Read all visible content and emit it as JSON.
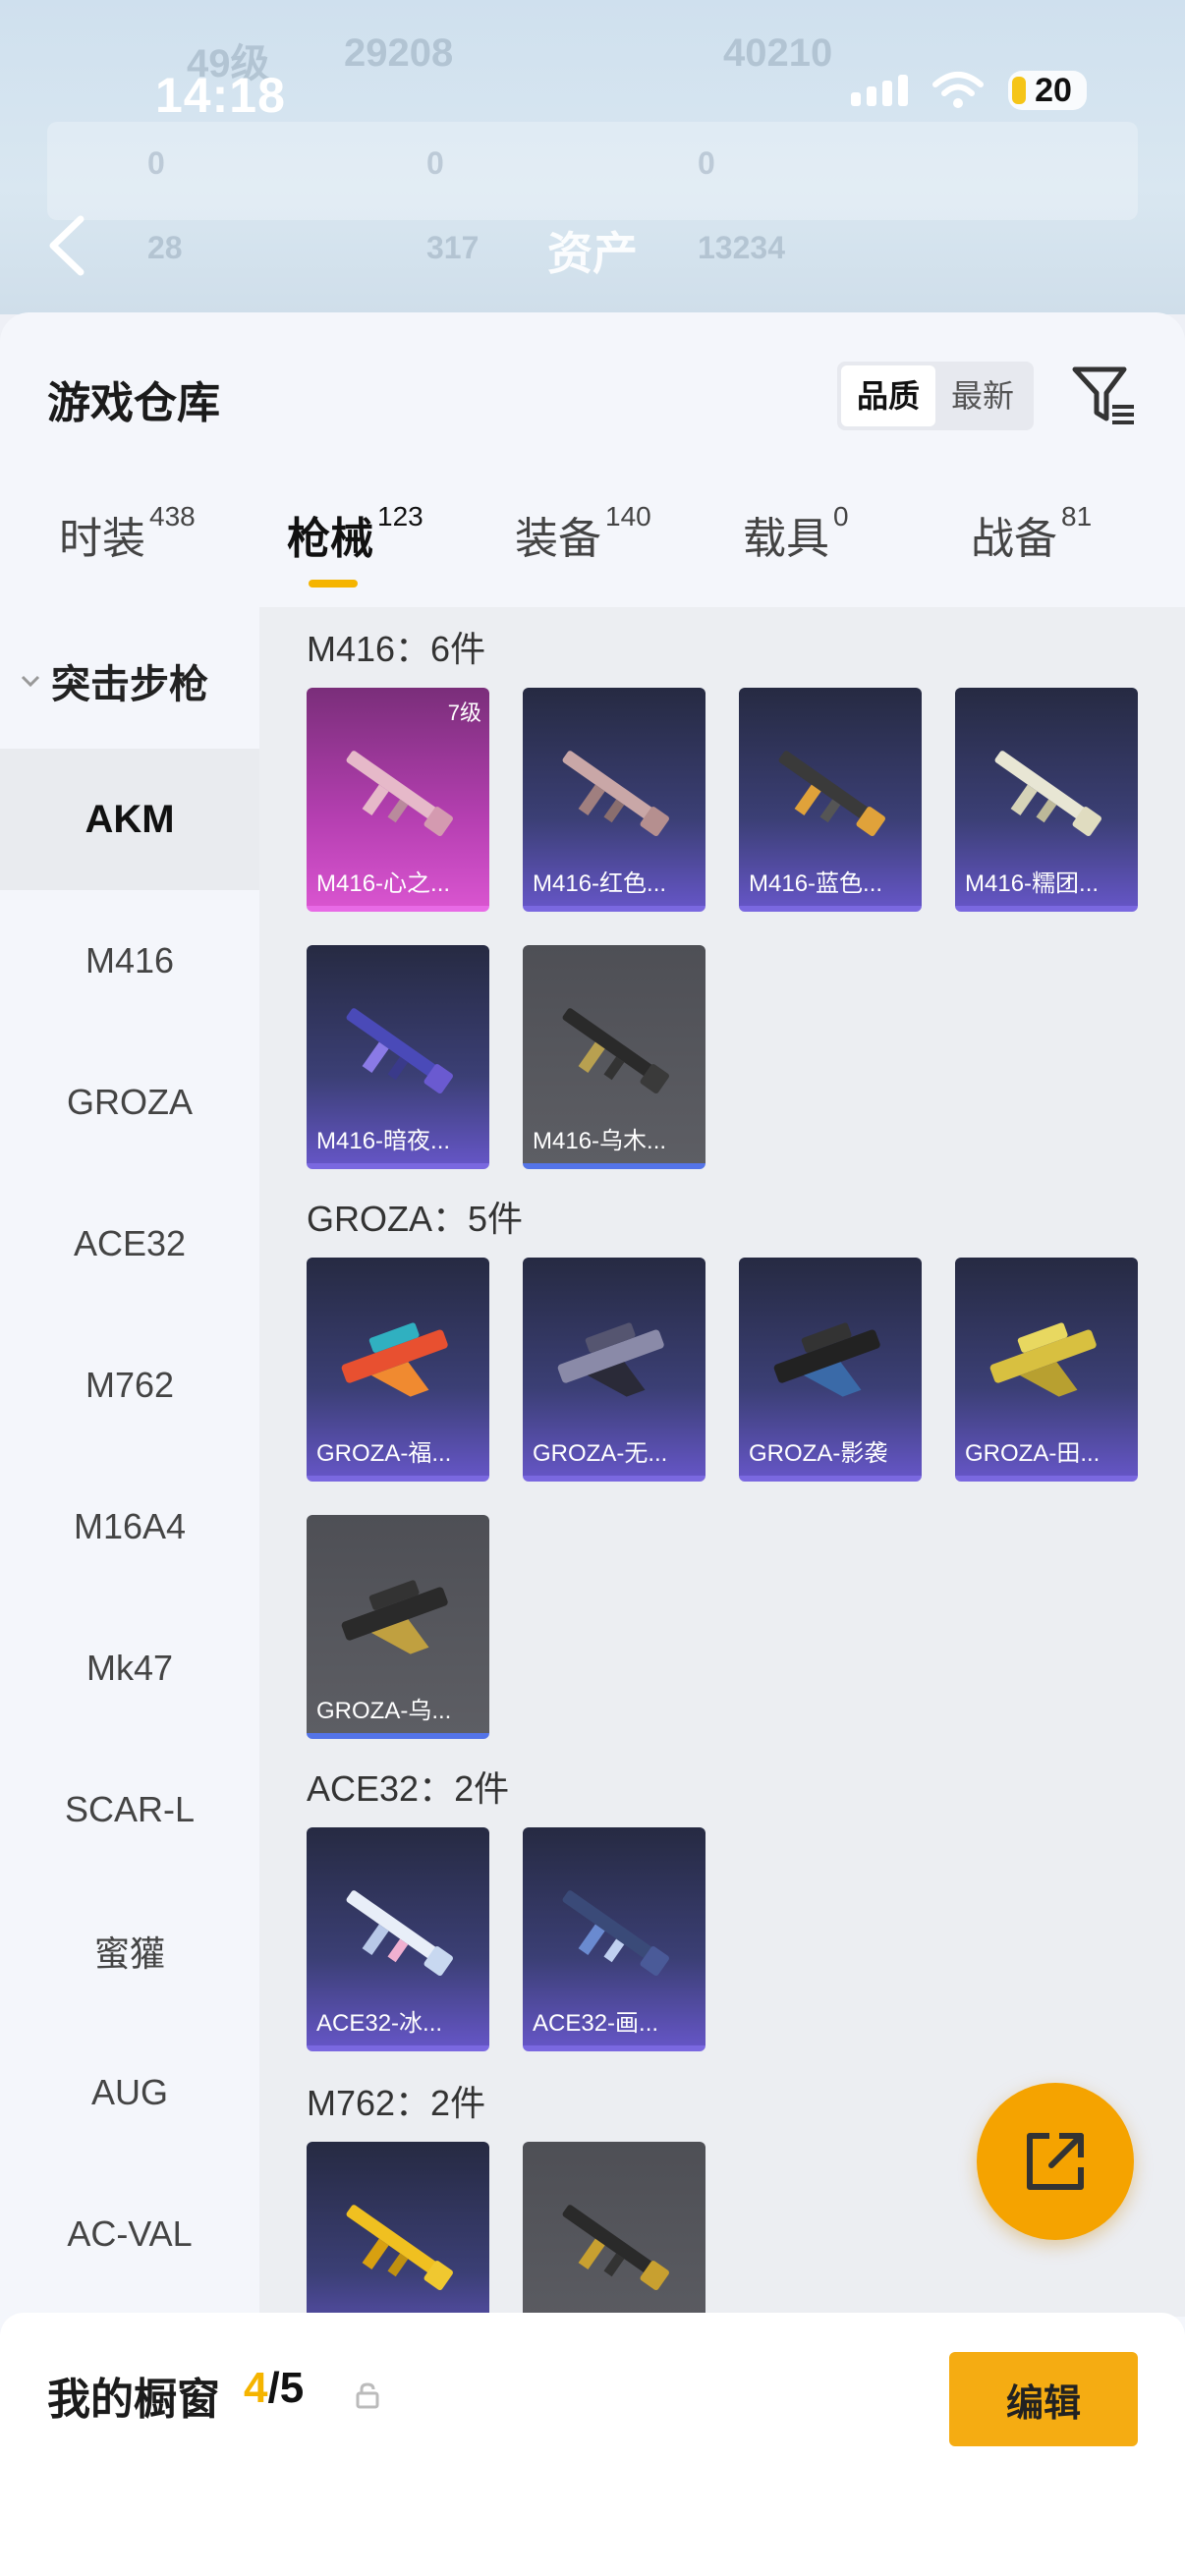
{
  "status_bar": {
    "time": "14:18",
    "battery": "20"
  },
  "header": {
    "title": "资产",
    "ghost_texts": [
      "49级",
      "29208",
      "40210",
      "0",
      "0",
      "0",
      "28",
      "317",
      "13234"
    ]
  },
  "card": {
    "title": "游戏仓库",
    "sort_options": [
      "品质",
      "最新"
    ],
    "tabs": [
      {
        "label": "时装",
        "count": "438"
      },
      {
        "label": "枪械",
        "count": "123"
      },
      {
        "label": "装备",
        "count": "140"
      },
      {
        "label": "载具",
        "count": "0"
      },
      {
        "label": "战备",
        "count": "81"
      }
    ]
  },
  "sidebar": {
    "category": "突击步枪",
    "items": [
      "AKM",
      "M416",
      "GROZA",
      "ACE32",
      "M762",
      "M16A4",
      "Mk47",
      "SCAR-L",
      "蜜獾",
      "AUG",
      "AC-VAL"
    ]
  },
  "groups": [
    {
      "title": "M416：6件",
      "items": [
        {
          "name": "M416-心之...",
          "level": "7级"
        },
        {
          "name": "M416-红色..."
        },
        {
          "name": "M416-蓝色..."
        },
        {
          "name": "M416-糯团..."
        },
        {
          "name": "M416-暗夜..."
        },
        {
          "name": "M416-乌木..."
        }
      ]
    },
    {
      "title": "GROZA：5件",
      "items": [
        {
          "name": "GROZA-福..."
        },
        {
          "name": "GROZA-无..."
        },
        {
          "name": "GROZA-影袭"
        },
        {
          "name": "GROZA-田..."
        },
        {
          "name": "GROZA-乌..."
        }
      ]
    },
    {
      "title": "ACE32：2件",
      "items": [
        {
          "name": "ACE32-冰..."
        },
        {
          "name": "ACE32-画..."
        }
      ]
    },
    {
      "title": "M762：2件",
      "items": [
        {
          "name": ""
        },
        {
          "name": ""
        }
      ]
    }
  ],
  "showcase": {
    "label": "我的橱窗",
    "current": "4",
    "total": "/5",
    "edit_label": "编辑"
  },
  "colors": {
    "accent": "#f5ac12",
    "underline": "#f5b400"
  }
}
